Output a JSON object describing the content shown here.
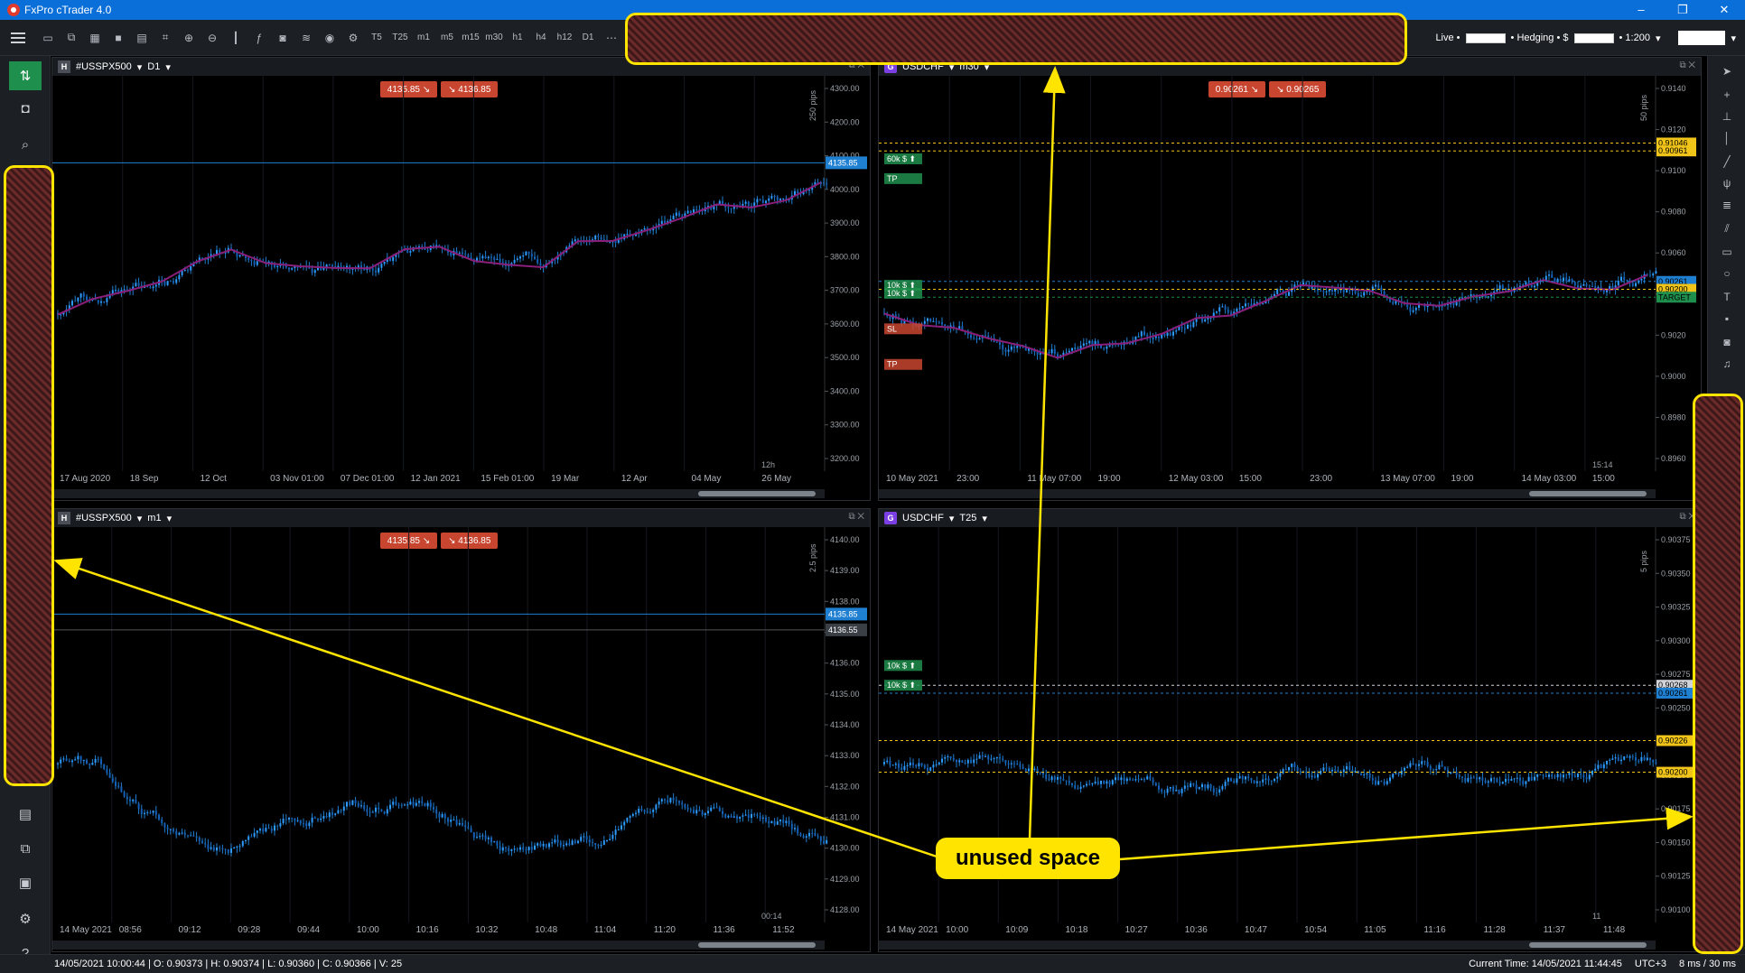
{
  "app": {
    "title": "FxPro cTrader 4.0",
    "win_min": "–",
    "win_max": "❐",
    "win_close": "✕"
  },
  "account": {
    "mode": "Live •",
    "hedging": "• Hedging • $",
    "leverage": "• 1:200"
  },
  "toolbar_labels": [
    "T5",
    "T25",
    "m1",
    "m5",
    "m15",
    "m30",
    "h1",
    "h4",
    "h12",
    "D1"
  ],
  "annotation": {
    "callout": "unused space"
  },
  "charts": [
    {
      "id": "tl",
      "symbol": "#USSPX500",
      "tf": "D1",
      "badge": "H",
      "bid": "4135.85",
      "ask": "4136.85",
      "scale_label": "250 pips",
      "price_tag": "4135.85",
      "clock": "12h",
      "y_ticks": [
        "4300.00",
        "4200.00",
        "4100.00",
        "4000.00",
        "3900.00",
        "3800.00",
        "3700.00",
        "3600.00",
        "3500.00",
        "3400.00",
        "3300.00",
        "3200.00"
      ],
      "x_ticks": [
        "17 Aug 2020",
        "18 Sep",
        "12 Oct",
        "03 Nov 01:00",
        "07 Dec 01:00",
        "12 Jan 2021",
        "15 Feb 01:00",
        "19 Mar",
        "12 Apr",
        "04 May",
        "26 May"
      ]
    },
    {
      "id": "tr",
      "symbol": "USDCHF",
      "tf": "m30",
      "badge": "G",
      "bid": "0.90261",
      "ask": "0.90265",
      "scale_label": "50 pips",
      "clock": "15:14",
      "y_ticks": [
        "0.9140",
        "0.9120",
        "0.9100",
        "0.9080",
        "0.9060",
        "0.9040",
        "0.9020",
        "0.9000",
        "0.8980",
        "0.8960"
      ],
      "x_ticks": [
        "10 May 2021",
        "23:00",
        "11 May 07:00",
        "19:00",
        "12 May 03:00",
        "15:00",
        "23:00",
        "13 May 07:00",
        "19:00",
        "14 May 03:00",
        "15:00"
      ],
      "price_tags": [
        {
          "label": "0.91046",
          "color": "#f0c419"
        },
        {
          "label": "0.90961",
          "color": "#f0c419"
        },
        {
          "label": "0.90261",
          "color": "#1f7fd1"
        },
        {
          "label": "0.90200",
          "color": "#f0c419"
        },
        {
          "label": "TARGET",
          "color": "#1e8f4c"
        }
      ],
      "orders": [
        {
          "label": "60k $ ⬆",
          "color": "#1e8f4c"
        },
        {
          "label": "TP",
          "color": "#1e8f4c"
        },
        {
          "label": "10k $ ⬆",
          "color": "#1e8f4c"
        },
        {
          "label": "10k $ ⬆",
          "color": "#1e8f4c"
        },
        {
          "label": "SL",
          "color": "#c8452f"
        },
        {
          "label": "TP",
          "color": "#c8452f"
        }
      ]
    },
    {
      "id": "bl",
      "symbol": "#USSPX500",
      "tf": "m1",
      "badge": "H",
      "bid": "4135.85",
      "ask": "4136.85",
      "scale_label": "2.5 pips",
      "price_tag": "4135.85",
      "price_tag2": "4136.55",
      "clock": "00:14",
      "y_ticks": [
        "4140.00",
        "4139.00",
        "4138.00",
        "4137.00",
        "4136.00",
        "4135.00",
        "4134.00",
        "4133.00",
        "4132.00",
        "4131.00",
        "4130.00",
        "4129.00",
        "4128.00"
      ],
      "x_ticks": [
        "14 May 2021",
        "08:56",
        "09:12",
        "09:28",
        "09:44",
        "10:00",
        "10:16",
        "10:32",
        "10:48",
        "11:04",
        "11:20",
        "11:36",
        "11:52"
      ]
    },
    {
      "id": "br",
      "symbol": "USDCHF",
      "tf": "T25",
      "badge": "G",
      "scale_label": "5 pips",
      "clock": "11",
      "y_ticks": [
        "0.90375",
        "0.90350",
        "0.90325",
        "0.90300",
        "0.90275",
        "0.90250",
        "0.90225",
        "0.90200",
        "0.90175",
        "0.90150",
        "0.90125",
        "0.90100"
      ],
      "x_ticks": [
        "14 May 2021",
        "10:00",
        "10:09",
        "10:18",
        "10:27",
        "10:36",
        "10:47",
        "10:54",
        "11:05",
        "11:16",
        "11:28",
        "11:37",
        "11:48"
      ],
      "price_tags": [
        {
          "label": "0.90268",
          "color": "#d0d4d9"
        },
        {
          "label": "0.90261",
          "color": "#1f7fd1"
        },
        {
          "label": "0.90226",
          "color": "#f0c419"
        },
        {
          "label": "0.90200",
          "color": "#f0c419"
        }
      ],
      "orders": [
        {
          "label": "10k $ ⬆",
          "color": "#1e8f4c"
        },
        {
          "label": "10k $ ⬆",
          "color": "#1e8f4c"
        }
      ]
    }
  ],
  "status": {
    "ohlc": "14/05/2021 10:00:44 | O: 0.90373 | H: 0.90374 | L: 0.90360 | C: 0.90366 | V: 25",
    "current_time": "Current Time: 14/05/2021 11:44:45",
    "tz": "UTC+3",
    "latency": "8 ms / 30 ms"
  }
}
